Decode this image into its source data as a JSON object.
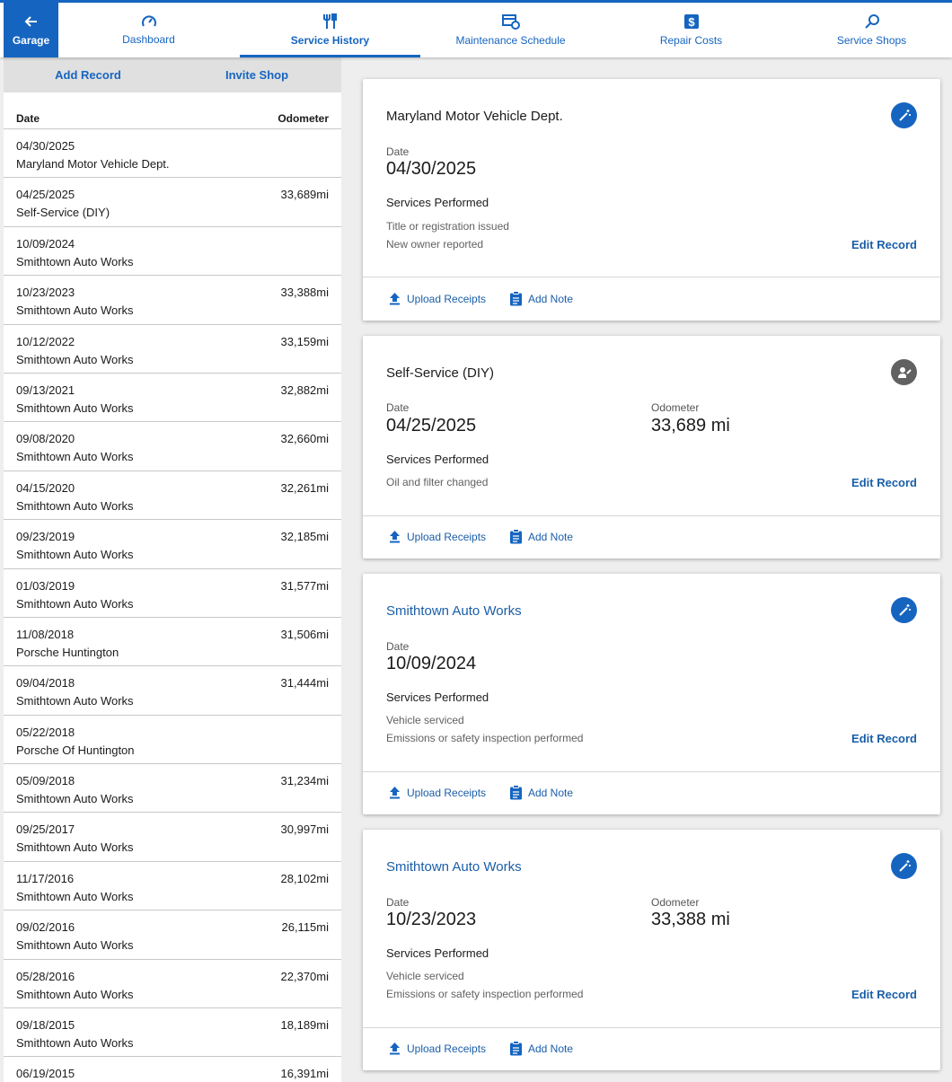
{
  "nav": {
    "garage_label": "Garage",
    "tabs": [
      {
        "label": "Dashboard",
        "icon": "gauge-icon"
      },
      {
        "label": "Service History",
        "icon": "tools-icon"
      },
      {
        "label": "Maintenance Schedule",
        "icon": "calendar-clock-icon"
      },
      {
        "label": "Repair Costs",
        "icon": "dollar-icon"
      },
      {
        "label": "Service Shops",
        "icon": "search-icon"
      }
    ],
    "active_tab": "Service History"
  },
  "sidebar": {
    "actions": {
      "add_record": "Add Record",
      "invite_shop": "Invite Shop"
    },
    "columns": {
      "date": "Date",
      "odometer": "Odometer"
    },
    "rows": [
      {
        "date": "04/30/2025",
        "shop": "Maryland Motor Vehicle Dept.",
        "odometer": ""
      },
      {
        "date": "04/25/2025",
        "shop": "Self-Service (DIY)",
        "odometer": "33,689mi"
      },
      {
        "date": "10/09/2024",
        "shop": "Smithtown Auto Works",
        "odometer": ""
      },
      {
        "date": "10/23/2023",
        "shop": "Smithtown Auto Works",
        "odometer": "33,388mi"
      },
      {
        "date": "10/12/2022",
        "shop": "Smithtown Auto Works",
        "odometer": "33,159mi"
      },
      {
        "date": "09/13/2021",
        "shop": "Smithtown Auto Works",
        "odometer": "32,882mi"
      },
      {
        "date": "09/08/2020",
        "shop": "Smithtown Auto Works",
        "odometer": "32,660mi"
      },
      {
        "date": "04/15/2020",
        "shop": "Smithtown Auto Works",
        "odometer": "32,261mi"
      },
      {
        "date": "09/23/2019",
        "shop": "Smithtown Auto Works",
        "odometer": "32,185mi"
      },
      {
        "date": "01/03/2019",
        "shop": "Smithtown Auto Works",
        "odometer": "31,577mi"
      },
      {
        "date": "11/08/2018",
        "shop": "Porsche Huntington",
        "odometer": "31,506mi"
      },
      {
        "date": "09/04/2018",
        "shop": "Smithtown Auto Works",
        "odometer": "31,444mi"
      },
      {
        "date": "05/22/2018",
        "shop": "Porsche Of Huntington",
        "odometer": ""
      },
      {
        "date": "05/09/2018",
        "shop": "Smithtown Auto Works",
        "odometer": "31,234mi"
      },
      {
        "date": "09/25/2017",
        "shop": "Smithtown Auto Works",
        "odometer": "30,997mi"
      },
      {
        "date": "11/17/2016",
        "shop": "Smithtown Auto Works",
        "odometer": "28,102mi"
      },
      {
        "date": "09/02/2016",
        "shop": "Smithtown Auto Works",
        "odometer": "26,115mi"
      },
      {
        "date": "05/28/2016",
        "shop": "Smithtown Auto Works",
        "odometer": "22,370mi"
      },
      {
        "date": "09/18/2015",
        "shop": "Smithtown Auto Works",
        "odometer": "18,189mi"
      },
      {
        "date": "06/19/2015",
        "shop": "",
        "odometer": "16,391mi"
      }
    ]
  },
  "cards": [
    {
      "title": "Maryland Motor Vehicle Dept.",
      "badge_icon": "magic-wand-icon",
      "date_label": "Date",
      "date": "04/30/2025",
      "services_label": "Services Performed",
      "services": [
        "Title or registration issued",
        "New owner reported"
      ],
      "edit_label": "Edit Record",
      "upload_label": "Upload Receipts",
      "note_label": "Add Note"
    },
    {
      "title": "Self-Service (DIY)",
      "badge_icon": "person-wrench-icon",
      "date_label": "Date",
      "date": "04/25/2025",
      "odometer_label": "Odometer",
      "odometer": "33,689 mi",
      "services_label": "Services Performed",
      "services": [
        "Oil and filter changed"
      ],
      "edit_label": "Edit Record",
      "upload_label": "Upload Receipts",
      "note_label": "Add Note"
    },
    {
      "title": "Smithtown Auto Works",
      "badge_icon": "magic-wand-icon",
      "date_label": "Date",
      "date": "10/09/2024",
      "services_label": "Services Performed",
      "services": [
        "Vehicle serviced",
        "Emissions or safety inspection performed"
      ],
      "edit_label": "Edit Record",
      "upload_label": "Upload Receipts",
      "note_label": "Add Note"
    },
    {
      "title": "Smithtown Auto Works",
      "badge_icon": "magic-wand-icon",
      "date_label": "Date",
      "date": "10/23/2023",
      "odometer_label": "Odometer",
      "odometer": "33,388 mi",
      "services_label": "Services Performed",
      "services": [
        "Vehicle serviced",
        "Emissions or safety inspection performed"
      ],
      "edit_label": "Edit Record",
      "upload_label": "Upload Receipts",
      "note_label": "Add Note"
    }
  ],
  "colors": {
    "accent": "#1565c0",
    "link": "#1a5ea8",
    "badge_grey": "#616161"
  }
}
